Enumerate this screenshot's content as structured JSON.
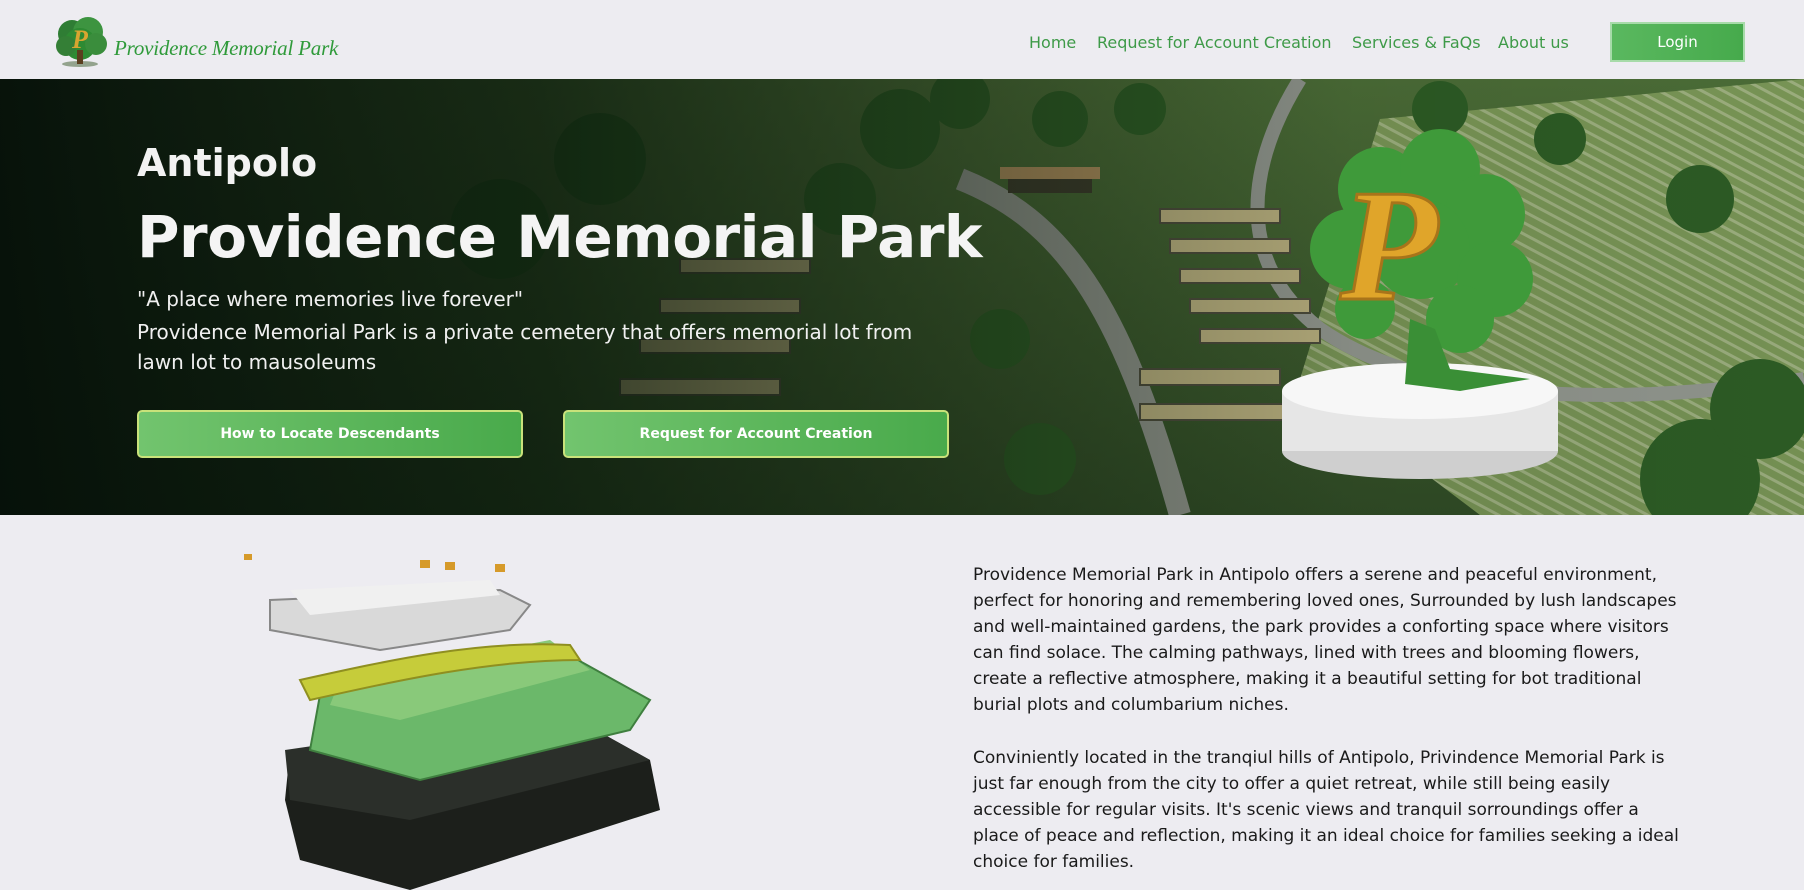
{
  "header": {
    "logo_text": "Providence Memorial Park",
    "nav": [
      "Home",
      "Request for Account Creation",
      "Services & FaQs",
      "About us"
    ],
    "login_label": "Login"
  },
  "hero": {
    "subtitle": "Antipolo",
    "title": "Providence Memorial Park",
    "tagline": "\"A place where memories live forever\"",
    "description": "Providence Memorial Park is a private cemetery that offers memorial lot from lawn lot to mausoleums",
    "buttons": [
      "How to Locate Descendants",
      "Request for Account Creation"
    ]
  },
  "content": {
    "paragraphs": [
      "Providence Memorial Park in Antipolo offers a serene and peaceful environment, perfect for honoring and remembering loved ones, Surrounded by lush landscapes and well-maintained gardens, the park provides a conforting space where visitors can find solace. The calming pathways, lined with trees and blooming flowers, create a reflective atmosphere, making it a beautiful setting for bot traditional burial plots and columbarium niches.",
      "Conviniently located in the tranqiul hills of Antipolo, Privindence Memorial Park is just far enough from the city to offer a quiet retreat, while still being easily accessible for regular visits. It's scenic views and tranquil sorroundings offer a place of peace and reflection, making it an ideal choice for families seeking a ideal choice for families."
    ]
  },
  "colors": {
    "brand_green": "#3e9a48",
    "button_green": "#4fae50",
    "page_bg": "#edecf1"
  },
  "icons": [
    "tree-p-logo-icon",
    "park-3d-model",
    "tree-p-emblem"
  ]
}
